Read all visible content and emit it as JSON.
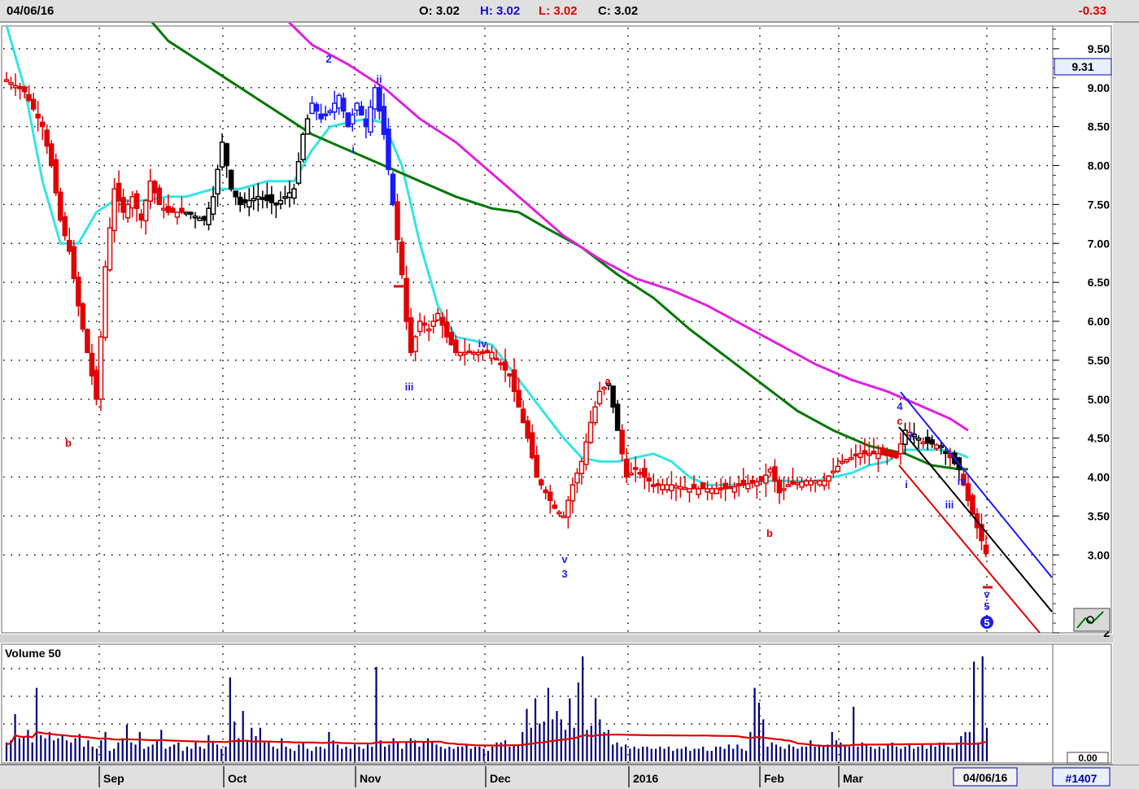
{
  "header": {
    "date": "04/06/16",
    "open": "O: 3.02",
    "high": "H: 3.02",
    "low": "L: 3.02",
    "close": "C: 3.02",
    "change": "-0.33"
  },
  "price_badge": "9.31",
  "volume_title": "Volume 50",
  "volume_axis_label": "0.00",
  "date_badge": "04/06/16",
  "bar_count": "#1407",
  "colors": {
    "up": "#e00000",
    "down_red": "#ff0000",
    "black": "#000000",
    "blue": "#1a1aff",
    "ma_fast": "#33e5e5",
    "ma_mid": "#007800",
    "ma_slow": "#e020e0",
    "volume_bar": "#00007a",
    "volume_ma": "#e00000",
    "grid_dot": "#000000"
  },
  "chart_data": {
    "type": "candlestick",
    "x_tick_labels": [
      "Sep",
      "Oct",
      "Nov",
      "Dec",
      "2016",
      "Feb",
      "Mar"
    ],
    "y_tick_labels": [
      "9.50",
      "9.00",
      "8.50",
      "8.00",
      "7.50",
      "7.00",
      "6.50",
      "6.00",
      "5.50",
      "5.00",
      "4.50",
      "4.00",
      "3.50",
      "3.00",
      "2"
    ],
    "ylim": [
      2.0,
      10.0
    ],
    "last_close": 3.02,
    "series": [
      {
        "name": "price",
        "points": [
          [
            0,
            9.1
          ],
          [
            4,
            8.95
          ],
          [
            8,
            8.5
          ],
          [
            10,
            8.0
          ],
          [
            12,
            7.3
          ],
          [
            14,
            6.9
          ],
          [
            16,
            6.2
          ],
          [
            18,
            5.6
          ],
          [
            20,
            5.0
          ],
          [
            21,
            5.8
          ],
          [
            22,
            6.7
          ],
          [
            24,
            7.7
          ],
          [
            26,
            7.4
          ],
          [
            28,
            7.6
          ],
          [
            30,
            7.3
          ],
          [
            32,
            7.8
          ],
          [
            34,
            7.5
          ],
          [
            36,
            7.4
          ],
          [
            40,
            7.4
          ],
          [
            44,
            7.3
          ],
          [
            46,
            7.6
          ],
          [
            48,
            8.3
          ],
          [
            50,
            7.7
          ],
          [
            52,
            7.5
          ],
          [
            56,
            7.6
          ],
          [
            60,
            7.5
          ],
          [
            64,
            7.7
          ],
          [
            66,
            8.4
          ],
          [
            68,
            8.8
          ],
          [
            70,
            8.6
          ],
          [
            72,
            8.7
          ],
          [
            74,
            8.9
          ],
          [
            76,
            8.5
          ],
          [
            78,
            8.8
          ],
          [
            80,
            8.5
          ],
          [
            82,
            9.0
          ],
          [
            84,
            8.4
          ],
          [
            86,
            7.5
          ],
          [
            88,
            6.6
          ],
          [
            89,
            6.0
          ],
          [
            90,
            5.6
          ],
          [
            92,
            6.0
          ],
          [
            94,
            5.9
          ],
          [
            96,
            6.1
          ],
          [
            98,
            5.8
          ],
          [
            100,
            5.6
          ],
          [
            104,
            5.6
          ],
          [
            108,
            5.6
          ],
          [
            112,
            5.3
          ],
          [
            116,
            4.5
          ],
          [
            118,
            4.0
          ],
          [
            122,
            3.6
          ],
          [
            124,
            3.5
          ],
          [
            126,
            3.9
          ],
          [
            128,
            4.2
          ],
          [
            130,
            4.7
          ],
          [
            132,
            5.1
          ],
          [
            134,
            5.2
          ],
          [
            136,
            4.6
          ],
          [
            138,
            4.0
          ],
          [
            140,
            4.1
          ],
          [
            144,
            3.9
          ],
          [
            148,
            3.9
          ],
          [
            152,
            3.85
          ],
          [
            156,
            3.85
          ],
          [
            160,
            3.85
          ],
          [
            164,
            3.9
          ],
          [
            168,
            3.95
          ],
          [
            170,
            4.1
          ],
          [
            172,
            3.8
          ],
          [
            174,
            3.9
          ],
          [
            178,
            3.95
          ],
          [
            182,
            3.95
          ],
          [
            186,
            4.2
          ],
          [
            190,
            4.3
          ],
          [
            194,
            4.3
          ],
          [
            198,
            4.25
          ],
          [
            200,
            4.6
          ],
          [
            202,
            4.55
          ],
          [
            204,
            4.45
          ],
          [
            208,
            4.4
          ],
          [
            212,
            4.1
          ],
          [
            214,
            3.7
          ],
          [
            216,
            3.35
          ],
          [
            218,
            3.02
          ]
        ]
      },
      {
        "name": "ma_fast",
        "points": [
          [
            0,
            9.8
          ],
          [
            4,
            9.0
          ],
          [
            8,
            7.8
          ],
          [
            12,
            7.0
          ],
          [
            16,
            7.0
          ],
          [
            20,
            7.4
          ],
          [
            24,
            7.55
          ],
          [
            30,
            7.55
          ],
          [
            36,
            7.6
          ],
          [
            40,
            7.6
          ],
          [
            46,
            7.7
          ],
          [
            52,
            7.7
          ],
          [
            58,
            7.8
          ],
          [
            64,
            7.8
          ],
          [
            68,
            8.2
          ],
          [
            72,
            8.5
          ],
          [
            76,
            8.55
          ],
          [
            80,
            8.6
          ],
          [
            84,
            8.55
          ],
          [
            88,
            8.0
          ],
          [
            92,
            7.0
          ],
          [
            96,
            6.2
          ],
          [
            100,
            5.8
          ],
          [
            104,
            5.75
          ],
          [
            108,
            5.7
          ],
          [
            112,
            5.4
          ],
          [
            116,
            5.1
          ],
          [
            120,
            4.8
          ],
          [
            124,
            4.5
          ],
          [
            128,
            4.25
          ],
          [
            132,
            4.2
          ],
          [
            136,
            4.2
          ],
          [
            140,
            4.25
          ],
          [
            144,
            4.3
          ],
          [
            148,
            4.2
          ],
          [
            152,
            4.0
          ],
          [
            156,
            3.9
          ],
          [
            160,
            3.9
          ],
          [
            164,
            3.9
          ],
          [
            168,
            3.95
          ],
          [
            172,
            3.95
          ],
          [
            176,
            3.95
          ],
          [
            180,
            3.95
          ],
          [
            184,
            4.0
          ],
          [
            188,
            4.05
          ],
          [
            192,
            4.15
          ],
          [
            196,
            4.2
          ],
          [
            200,
            4.35
          ],
          [
            204,
            4.35
          ],
          [
            208,
            4.35
          ],
          [
            212,
            4.3
          ],
          [
            214,
            4.25
          ]
        ]
      },
      {
        "name": "ma_mid",
        "points": [
          [
            30,
            10.0
          ],
          [
            36,
            9.6
          ],
          [
            44,
            9.3
          ],
          [
            52,
            9.0
          ],
          [
            60,
            8.7
          ],
          [
            68,
            8.4
          ],
          [
            76,
            8.2
          ],
          [
            84,
            8.0
          ],
          [
            92,
            7.8
          ],
          [
            100,
            7.6
          ],
          [
            108,
            7.45
          ],
          [
            114,
            7.4
          ],
          [
            120,
            7.2
          ],
          [
            128,
            6.95
          ],
          [
            136,
            6.6
          ],
          [
            144,
            6.3
          ],
          [
            152,
            5.9
          ],
          [
            160,
            5.55
          ],
          [
            168,
            5.2
          ],
          [
            176,
            4.85
          ],
          [
            184,
            4.6
          ],
          [
            192,
            4.4
          ],
          [
            200,
            4.3
          ],
          [
            206,
            4.15
          ],
          [
            212,
            4.1
          ],
          [
            214,
            4.1
          ]
        ]
      },
      {
        "name": "ma_slow",
        "points": [
          [
            60,
            10.0
          ],
          [
            68,
            9.55
          ],
          [
            76,
            9.3
          ],
          [
            84,
            9.0
          ],
          [
            92,
            8.6
          ],
          [
            100,
            8.3
          ],
          [
            108,
            7.9
          ],
          [
            116,
            7.5
          ],
          [
            124,
            7.1
          ],
          [
            132,
            6.8
          ],
          [
            140,
            6.55
          ],
          [
            148,
            6.4
          ],
          [
            156,
            6.2
          ],
          [
            164,
            5.95
          ],
          [
            172,
            5.7
          ],
          [
            180,
            5.45
          ],
          [
            188,
            5.25
          ],
          [
            196,
            5.1
          ],
          [
            204,
            4.9
          ],
          [
            210,
            4.75
          ],
          [
            214,
            4.6
          ]
        ]
      }
    ],
    "wave_labels": [
      "2",
      "ii",
      "i",
      "iii",
      "iv",
      "b",
      "3",
      "v",
      "a",
      "b",
      "4",
      "c",
      "ii",
      "i",
      "iii",
      "iv",
      "v",
      "5",
      "5"
    ],
    "volume_values": [
      18,
      20,
      45,
      22,
      24,
      30,
      18,
      70,
      25,
      22,
      28,
      20,
      22,
      25,
      20,
      18,
      22,
      26,
      14,
      20,
      14,
      12,
      20,
      28,
      10,
      12,
      18,
      22,
      35,
      18,
      16,
      28,
      12,
      14,
      16,
      20,
      30,
      12,
      14,
      16,
      18,
      10,
      14,
      12,
      18,
      14,
      12,
      25,
      18,
      16,
      12,
      14,
      80,
      38,
      22,
      48,
      20,
      32,
      24,
      32,
      18,
      18,
      14,
      12,
      22,
      14,
      12,
      10,
      16,
      18,
      12,
      10,
      14,
      14,
      12,
      28,
      20,
      16,
      12,
      14,
      12,
      16,
      14,
      12,
      16,
      14,
      90,
      20,
      14,
      16,
      22,
      18,
      12,
      18,
      22,
      20,
      14,
      18,
      22,
      18,
      16,
      14,
      12,
      14,
      12,
      14,
      14,
      16,
      12,
      14,
      14,
      12,
      10,
      14,
      18,
      18,
      20,
      14,
      16,
      16,
      28,
      50,
      32,
      60,
      36,
      38,
      70,
      40,
      48,
      40,
      30,
      60,
      32,
      75,
      100,
      30,
      34,
      60,
      40,
      28,
      30,
      16,
      18,
      14,
      16,
      12,
      14,
      12,
      14,
      14,
      12,
      12,
      14,
      12,
      14,
      10,
      12,
      12,
      14,
      10,
      12,
      12,
      14,
      10,
      10,
      14,
      14,
      12,
      16,
      12,
      16,
      12,
      10,
      28,
      70,
      56,
      40,
      14,
      18,
      16,
      14,
      12,
      16,
      14,
      12,
      14,
      14,
      20,
      14,
      16,
      14,
      16,
      28,
      20,
      18,
      16,
      14,
      52,
      14,
      18,
      16,
      14,
      12,
      14,
      12,
      16,
      18,
      14,
      12,
      14,
      16,
      12,
      14,
      16,
      12,
      16,
      14,
      18,
      18,
      14,
      12,
      18,
      24,
      28,
      28,
      95,
      18,
      100,
      32
    ],
    "volume_ylim": [
      0,
      110
    ]
  }
}
